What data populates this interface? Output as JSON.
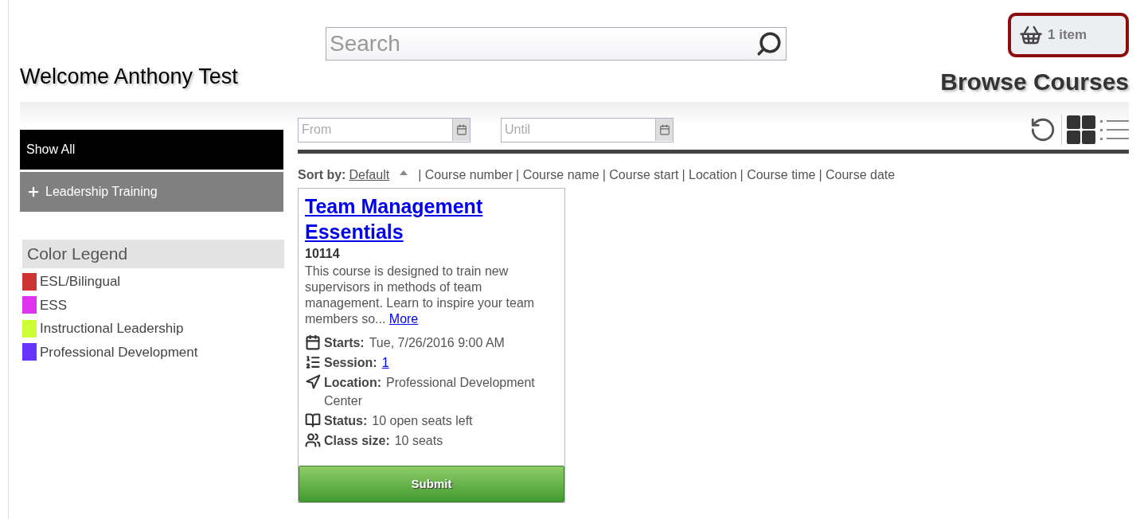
{
  "header": {
    "search": {
      "placeholder": "Search"
    },
    "welcome": "Welcome Anthony Test",
    "cart": {
      "label": "1 item"
    },
    "title": "Browse Courses"
  },
  "sidebar": {
    "categories": [
      {
        "label": "Show All",
        "selected": true,
        "expandable": false
      },
      {
        "label": "Leadership Training",
        "selected": false,
        "expandable": true
      }
    ],
    "legend": {
      "title": "Color Legend",
      "items": [
        {
          "label": "ESL/Bilingual",
          "color": "#cc3333"
        },
        {
          "label": "ESS",
          "color": "#dd33ee"
        },
        {
          "label": "Instructional Leadership",
          "color": "#ccff33"
        },
        {
          "label": "Professional Development",
          "color": "#6633ff"
        }
      ]
    }
  },
  "filters": {
    "from": {
      "placeholder": "From"
    },
    "until": {
      "placeholder": "Until"
    },
    "views": [
      {
        "kind": "grid",
        "selected": true
      },
      {
        "kind": "list",
        "selected": false
      }
    ]
  },
  "sort": {
    "label": "Sort by:",
    "options": [
      {
        "label": "Default",
        "selected": true
      },
      {
        "label": "| Course number",
        "selected": false
      },
      {
        "label": "| Course name",
        "selected": false
      },
      {
        "label": "| Course start",
        "selected": false
      },
      {
        "label": "| Location",
        "selected": false
      },
      {
        "label": "| Course time",
        "selected": false
      },
      {
        "label": "| Course date",
        "selected": false
      }
    ]
  },
  "courses": [
    {
      "title": "Team Management Essentials",
      "number": "10114",
      "description": "This course is designed to train new supervisors in methods of team management. Learn to inspire your team members so...",
      "more": "More",
      "details": [
        {
          "kind": "calendar",
          "label": "Starts:",
          "value": "Tue, 7/26/2016 9:00 AM",
          "link": false
        },
        {
          "kind": "session",
          "label": "Session:",
          "value": "1",
          "link": true
        },
        {
          "kind": "location",
          "label": "Location:",
          "value": "Professional Development Center",
          "link": false
        },
        {
          "kind": "status",
          "label": "Status:",
          "value": "10 open seats left",
          "link": false
        },
        {
          "kind": "people",
          "label": "Class size:",
          "value": "10 seats",
          "link": false
        }
      ],
      "button": "Submit"
    }
  ]
}
